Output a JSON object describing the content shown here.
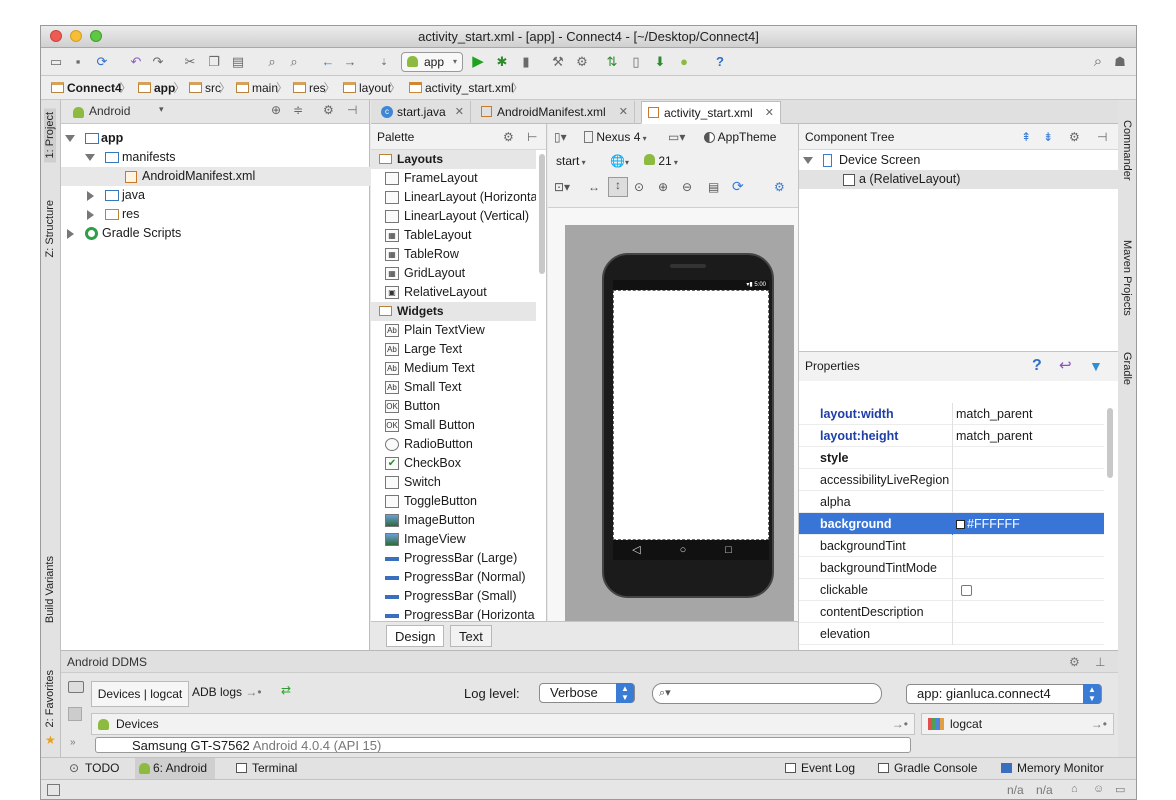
{
  "window": {
    "title": "activity_start.xml - [app] - Connect4 - [~/Desktop/Connect4]"
  },
  "toolbar": {
    "run_config": "app"
  },
  "breadcrumbs": [
    "Connect4",
    "app",
    "src",
    "main",
    "res",
    "layout",
    "activity_start.xml"
  ],
  "left_strip": {
    "project": "1: Project",
    "structure": "Z: Structure",
    "build_variants": "Build Variants",
    "favorites": "2: Favorites"
  },
  "right_strip": {
    "commander": "Commander",
    "maven": "Maven Projects",
    "gradle": "Gradle"
  },
  "project": {
    "view": "Android",
    "tree": [
      {
        "label": "app",
        "bold": true
      },
      {
        "label": "manifests"
      },
      {
        "label": "AndroidManifest.xml"
      },
      {
        "label": "java"
      },
      {
        "label": "res"
      },
      {
        "label": "Gradle Scripts"
      }
    ]
  },
  "tabs": [
    {
      "label": "start.java"
    },
    {
      "label": "AndroidManifest.xml"
    },
    {
      "label": "activity_start.xml"
    }
  ],
  "palette": {
    "title": "Palette",
    "sections": [
      {
        "name": "Layouts",
        "items": [
          "FrameLayout",
          "LinearLayout (Horizonta",
          "LinearLayout (Vertical)",
          "TableLayout",
          "TableRow",
          "GridLayout",
          "RelativeLayout"
        ]
      },
      {
        "name": "Widgets",
        "items": [
          "Plain TextView",
          "Large Text",
          "Medium Text",
          "Small Text",
          "Button",
          "Small Button",
          "RadioButton",
          "CheckBox",
          "Switch",
          "ToggleButton",
          "ImageButton",
          "ImageView",
          "ProgressBar (Large)",
          "ProgressBar (Normal)",
          "ProgressBar (Small)",
          "ProgressBar (Horizonta"
        ]
      }
    ]
  },
  "designbar": {
    "device": "Nexus 4",
    "theme": "AppTheme",
    "activity": "start",
    "api": "21"
  },
  "phone": {
    "status_time": "5:00",
    "nav": "◁ ○ □"
  },
  "mode_tabs": {
    "design": "Design",
    "text": "Text"
  },
  "component_tree": {
    "title": "Component Tree",
    "items": [
      {
        "label": "Device Screen"
      },
      {
        "label": "a (RelativeLayout)"
      }
    ]
  },
  "properties": {
    "title": "Properties",
    "rows": [
      {
        "name": "layout:width",
        "value": "match_parent"
      },
      {
        "name": "layout:height",
        "value": "match_parent"
      },
      {
        "name": "style",
        "value": ""
      },
      {
        "name": "accessibilityLiveRegion",
        "value": ""
      },
      {
        "name": "alpha",
        "value": ""
      },
      {
        "name": "background",
        "value": "#FFFFFF"
      },
      {
        "name": "backgroundTint",
        "value": ""
      },
      {
        "name": "backgroundTintMode",
        "value": ""
      },
      {
        "name": "clickable",
        "value": ""
      },
      {
        "name": "contentDescription",
        "value": ""
      },
      {
        "name": "elevation",
        "value": ""
      }
    ]
  },
  "ddms": {
    "title": "Android DDMS",
    "tab_devices": "Devices | logcat",
    "tab_adb": "ADB logs",
    "log_level_label": "Log level:",
    "log_level": "Verbose",
    "app_filter": "app: gianluca.connect4",
    "devices_label": "Devices",
    "device": "Samsung GT-S7562",
    "device_detail": "Android 4.0.4 (API 15)",
    "logcat_label": "logcat"
  },
  "bottom_bar": {
    "todo": "TODO",
    "android": "6: Android",
    "terminal": "Terminal",
    "event_log": "Event Log",
    "gradle_console": "Gradle Console",
    "memory_monitor": "Memory Monitor"
  },
  "status": {
    "na1": "n/a",
    "na2": "n/a"
  },
  "colors": {
    "accent": "#3875d7",
    "android_green": "#8cbb3f",
    "prop_blue": "#1e3fa8"
  }
}
